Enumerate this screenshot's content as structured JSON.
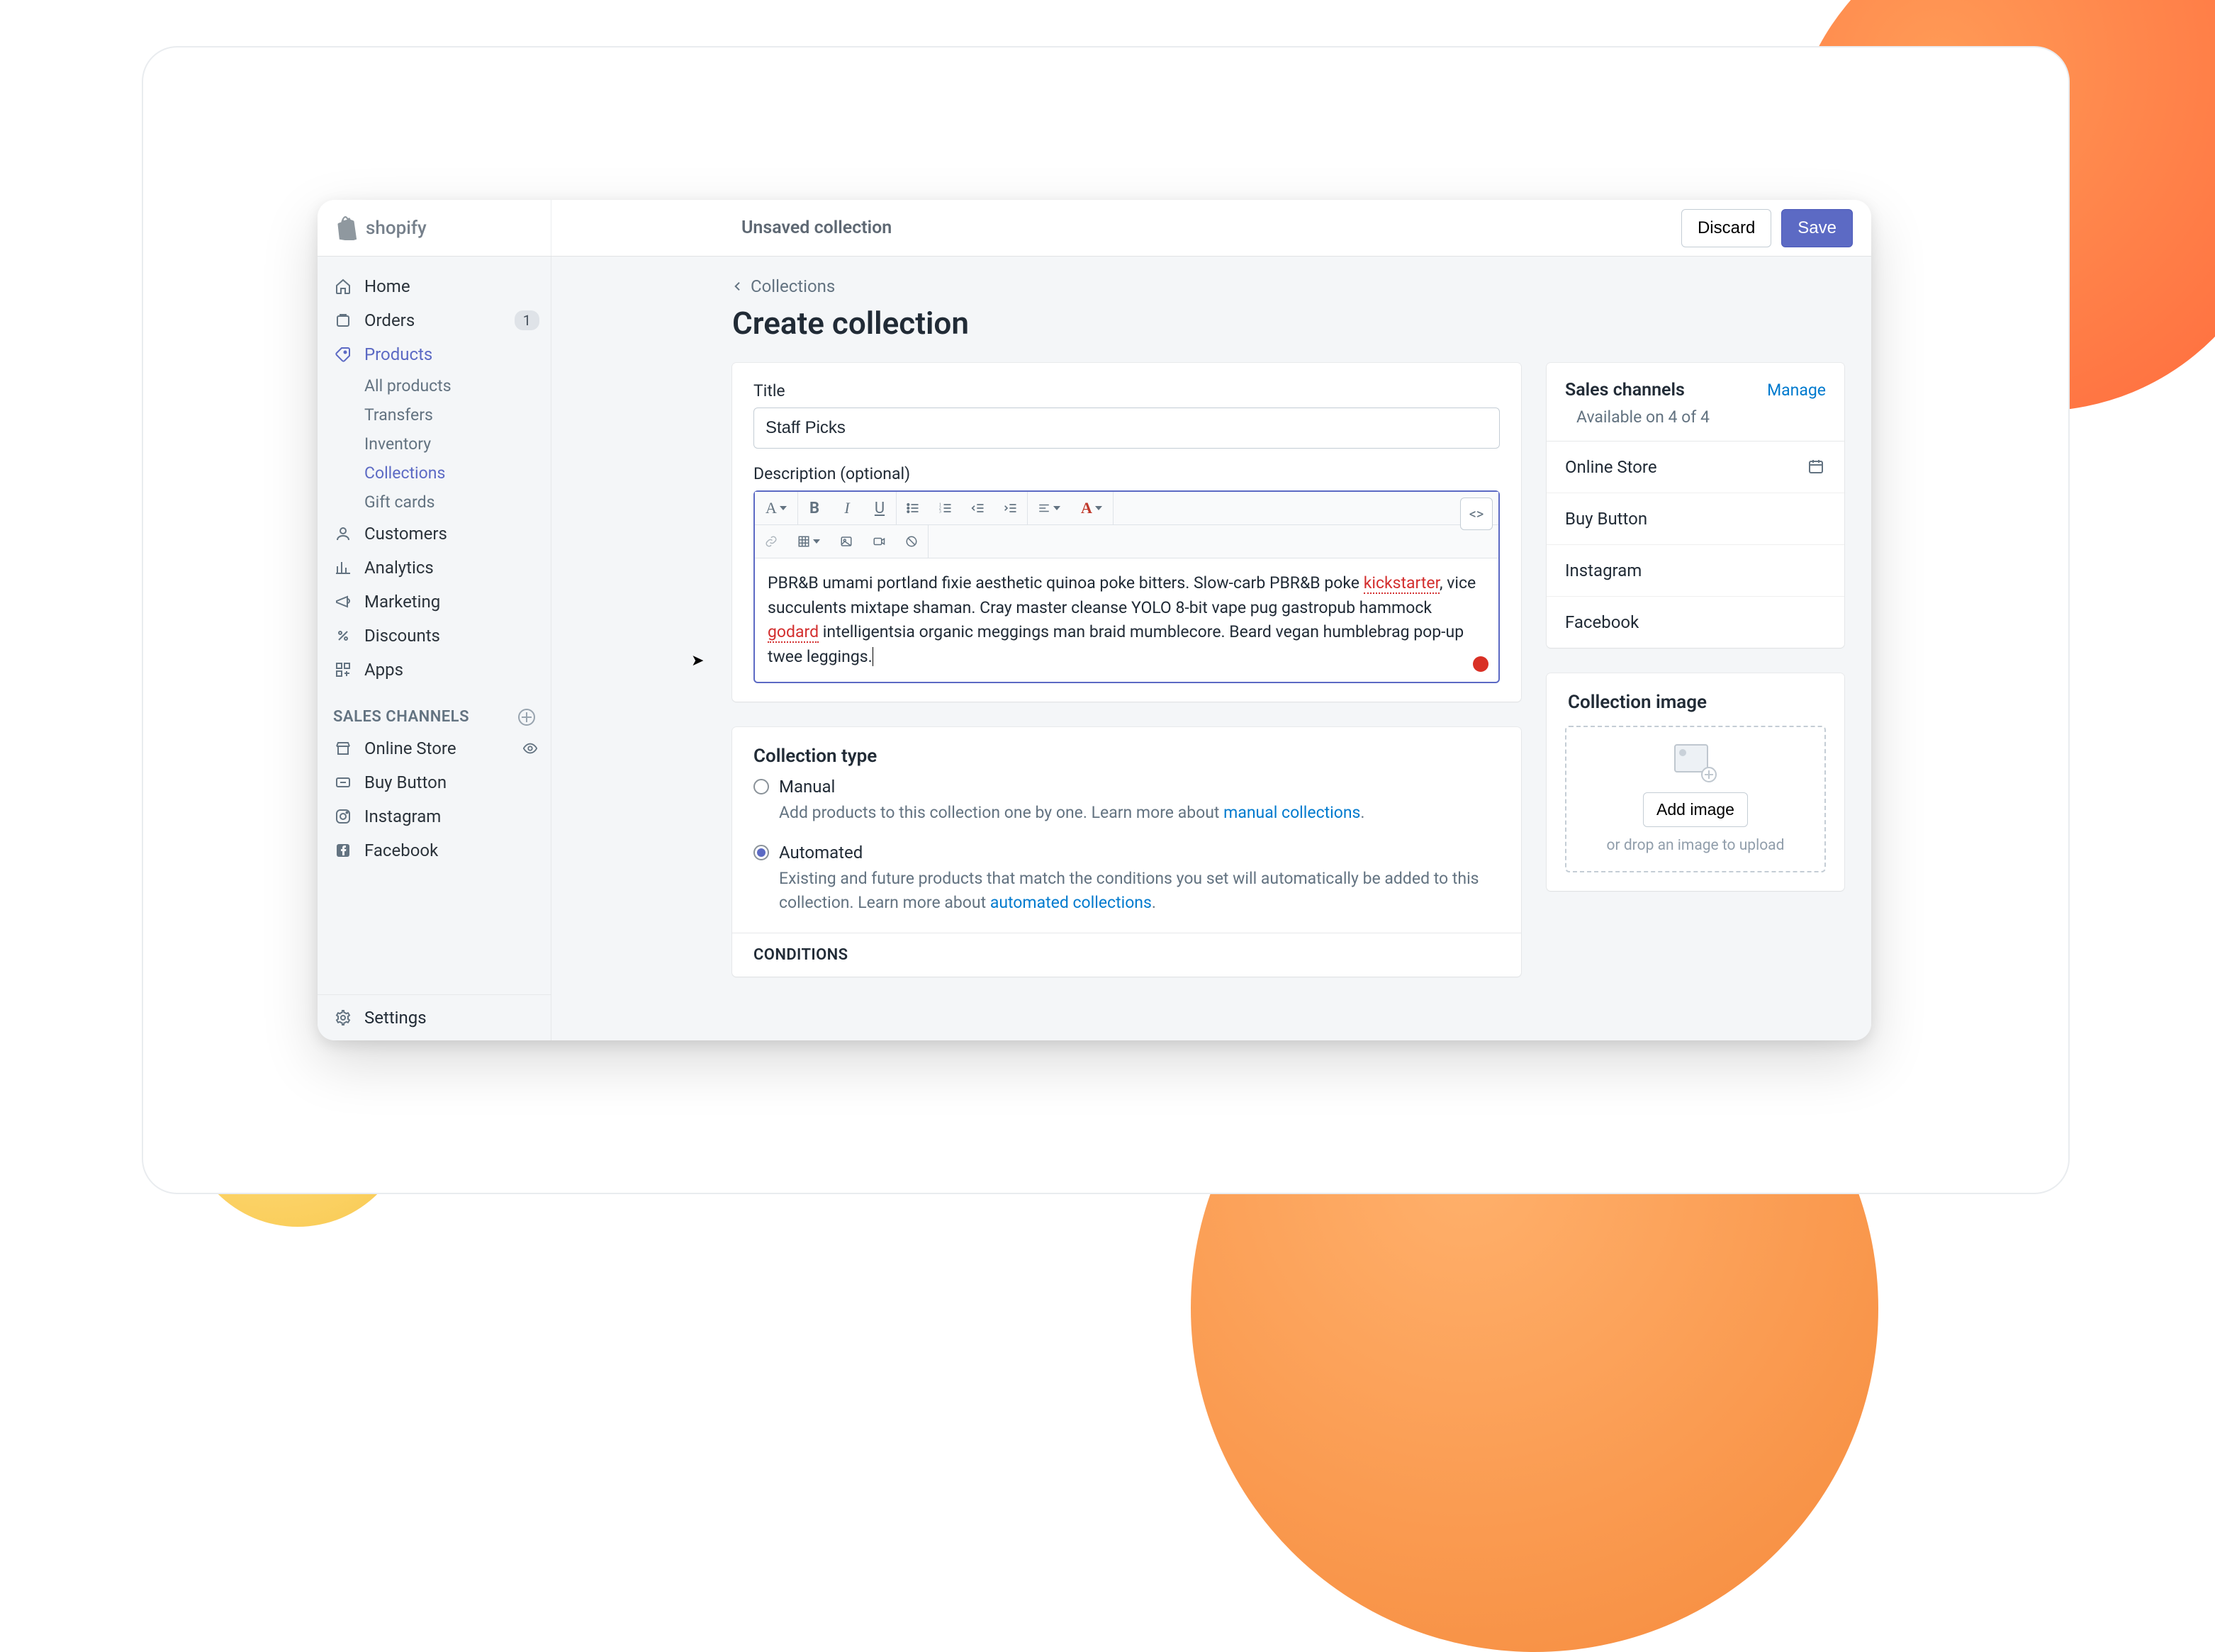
{
  "brand": {
    "name": "shopify"
  },
  "topbar": {
    "title": "Unsaved collection",
    "discard_label": "Discard",
    "save_label": "Save"
  },
  "sidebar": {
    "items": [
      {
        "label": "Home",
        "icon": "home-icon"
      },
      {
        "label": "Orders",
        "icon": "orders-icon",
        "badge": "1"
      },
      {
        "label": "Products",
        "icon": "products-icon",
        "selected": true
      },
      {
        "label": "Customers",
        "icon": "customers-icon"
      },
      {
        "label": "Analytics",
        "icon": "analytics-icon"
      },
      {
        "label": "Marketing",
        "icon": "marketing-icon"
      },
      {
        "label": "Discounts",
        "icon": "discounts-icon"
      },
      {
        "label": "Apps",
        "icon": "apps-icon"
      }
    ],
    "product_subitems": [
      {
        "label": "All products"
      },
      {
        "label": "Transfers"
      },
      {
        "label": "Inventory"
      },
      {
        "label": "Collections",
        "active": true
      },
      {
        "label": "Gift cards"
      }
    ],
    "channels_header": "SALES CHANNELS",
    "channels": [
      {
        "label": "Online Store",
        "icon": "online-store-icon",
        "has_view": true
      },
      {
        "label": "Buy Button",
        "icon": "buy-button-icon"
      },
      {
        "label": "Instagram",
        "icon": "instagram-icon"
      },
      {
        "label": "Facebook",
        "icon": "facebook-icon"
      }
    ],
    "settings_label": "Settings"
  },
  "main": {
    "breadcrumb": "Collections",
    "heading": "Create collection",
    "title_label": "Title",
    "title_value": "Staff Picks",
    "desc_label": "Description (optional)",
    "desc_body_part1": "PBR&B umami portland fixie aesthetic quinoa poke bitters. Slow-carb PBR&B poke ",
    "desc_body_squiggle1": "kickstarter",
    "desc_body_part2": ", vice succulents mixtape shaman. Cray master cleanse YOLO 8-bit vape pug gastropub hammock ",
    "desc_body_squiggle2": "godard",
    "desc_body_part3": " intelligentsia organic meggings man braid mumblecore. Beard vegan humblebrag pop-up twee leggings.",
    "type": {
      "header": "Collection type",
      "manual_label": "Manual",
      "manual_help_pre": "Add products to this collection one by one. Learn more about ",
      "manual_help_link": "manual collections",
      "automated_label": "Automated",
      "automated_help_pre": "Existing and future products that match the conditions you set will automatically be added to this collection. Learn more about ",
      "automated_help_link": "automated collections",
      "conditions_header": "CONDITIONS"
    }
  },
  "side": {
    "sales_header": "Sales channels",
    "manage_label": "Manage",
    "availability": "Available on 4 of 4",
    "channels": [
      {
        "label": "Online Store",
        "has_calendar": true
      },
      {
        "label": "Buy Button"
      },
      {
        "label": "Instagram"
      },
      {
        "label": "Facebook"
      }
    ],
    "image_header": "Collection image",
    "add_image_label": "Add image",
    "drop_hint": "or drop an image to upload"
  }
}
